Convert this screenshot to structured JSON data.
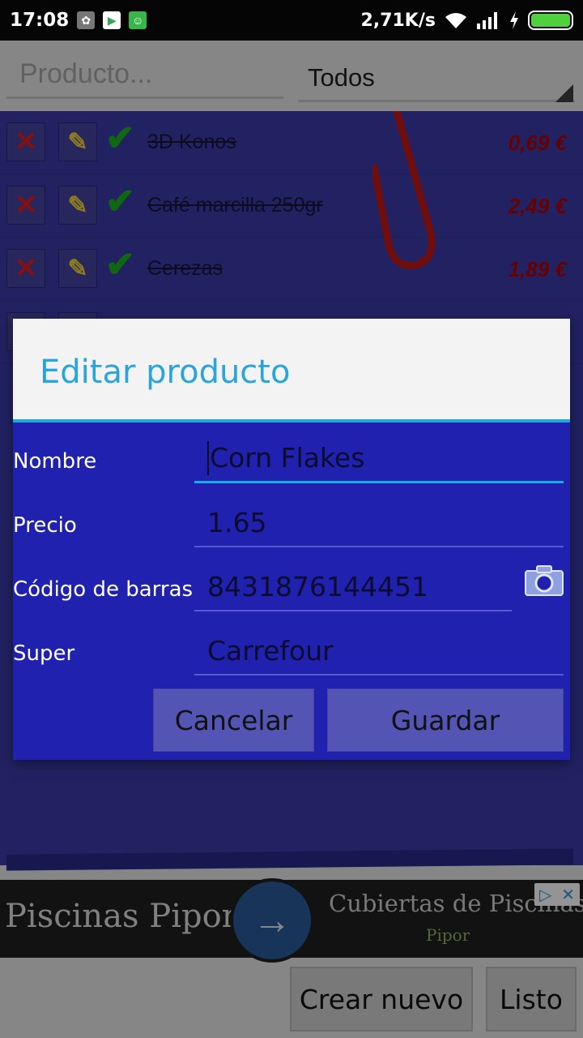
{
  "status_bar": {
    "time": "17:08",
    "network_speed": "2,71K/s",
    "battery_level_percent": 100,
    "icons": [
      "app-notification-icon",
      "play-store-icon",
      "android-icon",
      "wifi-icon",
      "signal-icon",
      "charging-icon",
      "battery-icon"
    ]
  },
  "toolbar": {
    "search_placeholder": "Producto...",
    "filter_value": "Todos"
  },
  "products": [
    {
      "name": "3D Konos",
      "price": "0,69 €"
    },
    {
      "name": "Café marcilla 250gr",
      "price": "2,49 €"
    },
    {
      "name": "Cerezas",
      "price": "1,89 €"
    }
  ],
  "dialog": {
    "title": "Editar producto",
    "fields": {
      "name_label": "Nombre",
      "name_value": "Corn Flakes",
      "price_label": "Precio",
      "price_value": "1.65",
      "barcode_label": "Código de barras",
      "barcode_value": "8431876144451",
      "store_label": "Super",
      "store_value": "Carrefour"
    },
    "cancel_label": "Cancelar",
    "save_label": "Guardar"
  },
  "ad": {
    "brand": "Piscinas Pipor",
    "headline": "Cubiertas de Piscinas",
    "advertiser": "Pipor"
  },
  "bottom": {
    "create_label": "Crear nuevo",
    "done_label": "Listo"
  },
  "colors": {
    "accent": "#1fa9e1",
    "dialog_bg": "#2121b0",
    "price": "#b40000"
  }
}
